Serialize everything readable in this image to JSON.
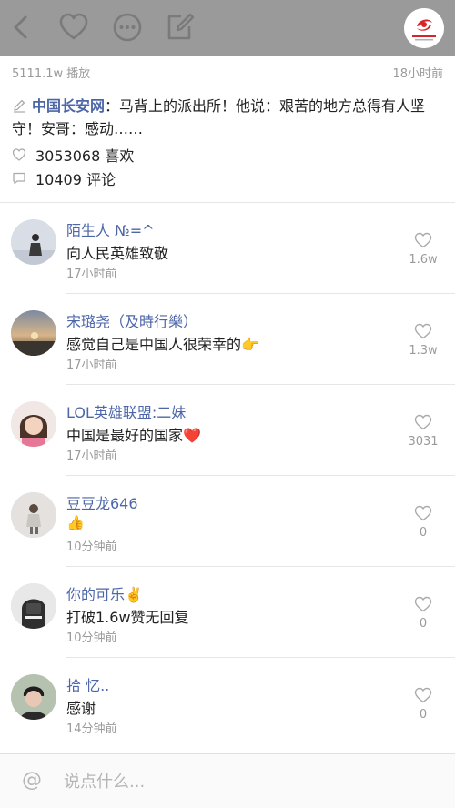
{
  "header": {
    "logo_text": "中国长安网"
  },
  "stats": {
    "plays": "5111.1w 播放",
    "time": "18小时前"
  },
  "post": {
    "author": "中国长安网",
    "body": "：马背上的派出所！他说：艰苦的地方总得有人坚守！安哥：感动……",
    "likes": "3053068 喜欢",
    "comments": "10409 评论"
  },
  "comments": [
    {
      "name": "陌生人 №=^",
      "text": "向人民英雄致敬",
      "time": "17小时前",
      "likes": "1.6w"
    },
    {
      "name": "宋璐尧（及時行樂）",
      "text": "感觉自己是中国人很荣幸的👉",
      "time": "17小时前",
      "likes": "1.3w"
    },
    {
      "name": "LOL英雄联盟:二妹",
      "text": "中国是最好的国家❤️",
      "time": "17小时前",
      "likes": "3031"
    },
    {
      "name": "豆豆龙646",
      "text": "👍",
      "time": "10分钟前",
      "likes": "0"
    },
    {
      "name": "你的可乐✌️",
      "text": "打破1.6w赞无回复",
      "time": "10分钟前",
      "likes": "0"
    },
    {
      "name": "拾 忆..",
      "text": "感谢",
      "time": "14分钟前",
      "likes": "0"
    }
  ],
  "input": {
    "at_symbol": "@",
    "placeholder": "说点什么..."
  },
  "colors": {
    "topbar": "#9a9a9a",
    "link": "#4c66a8",
    "muted": "#9a9a9a",
    "logo_red": "#d8232a"
  }
}
